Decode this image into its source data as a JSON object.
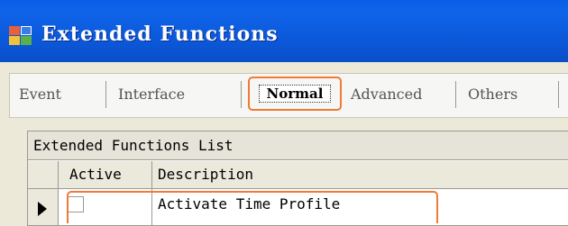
{
  "window": {
    "title": "Extended Functions",
    "app_icon": "app-grid-icon"
  },
  "tabs": [
    {
      "label": "Event",
      "selected": false
    },
    {
      "label": "Interface",
      "selected": false
    },
    {
      "label": "Normal",
      "selected": true
    },
    {
      "label": "Advanced",
      "selected": false
    },
    {
      "label": "Others",
      "selected": false
    }
  ],
  "list": {
    "caption": "Extended Functions List",
    "columns": [
      "Active",
      "Description"
    ],
    "rows": [
      {
        "active": false,
        "description": "Activate Time Profile"
      }
    ]
  },
  "colors": {
    "titlebar": "#0a5ee6",
    "highlight": "#f07a36",
    "window_bg": "#ece9d8"
  }
}
